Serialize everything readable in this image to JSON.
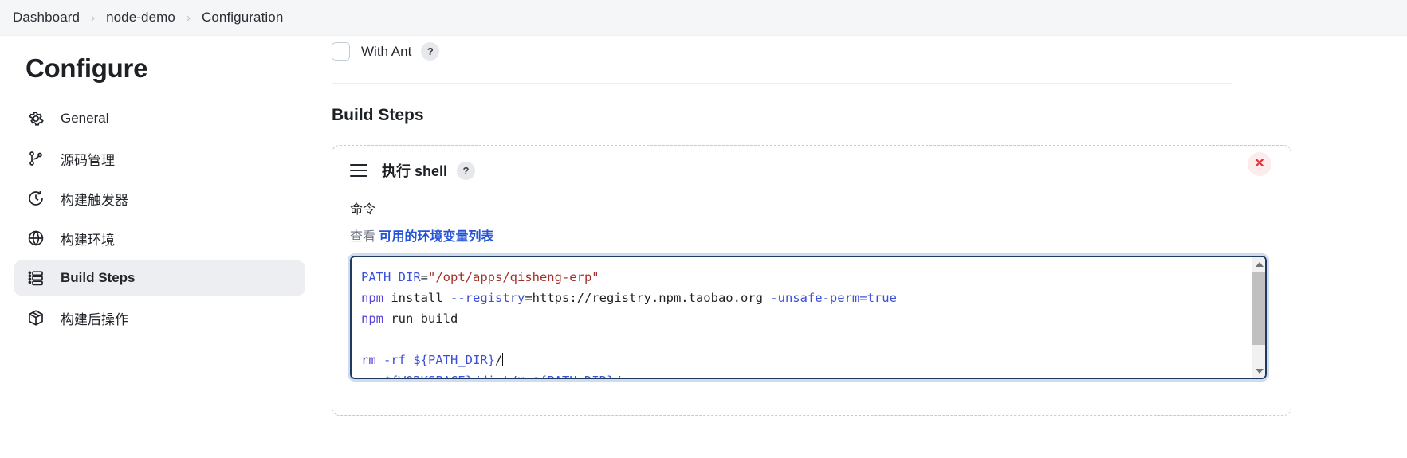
{
  "breadcrumb": {
    "items": [
      "Dashboard",
      "node-demo",
      "Configuration"
    ],
    "separator": "›"
  },
  "sidebar": {
    "title": "Configure",
    "items": [
      {
        "label": "General",
        "icon": "gear-icon",
        "active": false
      },
      {
        "label": "源码管理",
        "icon": "git-branch-icon",
        "active": false
      },
      {
        "label": "构建触发器",
        "icon": "clock-icon",
        "active": false
      },
      {
        "label": "构建环境",
        "icon": "globe-icon",
        "active": false
      },
      {
        "label": "Build Steps",
        "icon": "list-steps-icon",
        "active": true
      },
      {
        "label": "构建后操作",
        "icon": "package-icon",
        "active": false
      }
    ]
  },
  "main": {
    "with_ant": {
      "label": "With Ant",
      "checked": false,
      "help": "?"
    },
    "section_title": "Build Steps",
    "step": {
      "title": "执行 shell",
      "help": "?",
      "close": "✕",
      "command_label": "命令",
      "env_prefix": "查看",
      "env_link": "可用的环境变量列表",
      "code_lines": [
        {
          "tokens": [
            {
              "t": "PATH_DIR",
              "c": "var"
            },
            {
              "t": "=",
              "c": "plain"
            },
            {
              "t": "\"/opt/apps/qisheng-erp\"",
              "c": "str"
            }
          ]
        },
        {
          "tokens": [
            {
              "t": "npm",
              "c": "kw"
            },
            {
              "t": " install ",
              "c": "plain"
            },
            {
              "t": "--registry",
              "c": "flag"
            },
            {
              "t": "=https://registry.npm.taobao.org ",
              "c": "plain"
            },
            {
              "t": "-unsafe-perm=true",
              "c": "flag"
            }
          ]
        },
        {
          "tokens": [
            {
              "t": "npm",
              "c": "kw"
            },
            {
              "t": " run build",
              "c": "plain"
            }
          ]
        },
        {
          "tokens": []
        },
        {
          "tokens": [
            {
              "t": "rm",
              "c": "kw"
            },
            {
              "t": " -rf ",
              "c": "flag"
            },
            {
              "t": "${PATH_DIR}",
              "c": "flag"
            },
            {
              "t": "/",
              "c": "plain"
            }
          ],
          "caret": true
        },
        {
          "tokens": [
            {
              "t": "   ${WORKSPACE}/dist/* ${PATH_DIR}/",
              "c": "flag"
            }
          ]
        }
      ]
    }
  },
  "colors": {
    "accent_link": "#2453d6",
    "close_red": "#e8303d",
    "focus_border": "#1e3a5f",
    "sidebar_active_bg": "#eceef1",
    "breadcrumb_bg": "#f5f6f8"
  }
}
